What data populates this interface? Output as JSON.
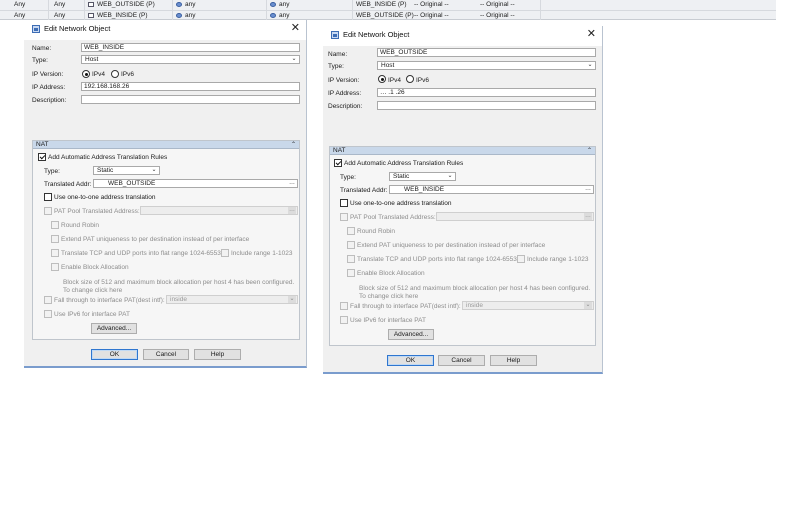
{
  "background_table": {
    "rows": [
      {
        "src_if": "Any",
        "dst_if": "Any",
        "src": "WEB_OUTSIDE (P)",
        "dst": "any",
        "svc": "any",
        "t_src": "WEB_INSIDE (P)",
        "t_dst": "-- Original --",
        "t_svc": "-- Original --"
      },
      {
        "src_if": "Any",
        "dst_if": "Any",
        "src": "WEB_INSIDE (P)",
        "dst": "any",
        "svc": "any",
        "t_src": "WEB_OUTSIDE (P)",
        "t_dst": "-- Original --",
        "t_svc": "-- Original --"
      }
    ]
  },
  "dialogs": [
    {
      "title": "Edit Network Object",
      "labels": {
        "name": "Name:",
        "type": "Type:",
        "ip_version": "IP Version:",
        "ip_address": "IP Address:",
        "description": "Description:"
      },
      "name_value": "WEB_INSIDE",
      "type_value": "Host",
      "ipv4_label": "IPv4",
      "ipv6_label": "IPv6",
      "ip_value": "192.168.168.26",
      "description_value": "",
      "nat": {
        "header": "NAT",
        "add_rules_label": "Add Automatic Address Translation Rules",
        "type_label": "Type:",
        "type_value": "Static",
        "translated_label": "Translated Addr:",
        "translated_value": "WEB_OUTSIDE",
        "one_to_one_label": "Use one-to-one address translation",
        "pat_pool_label": "PAT Pool Translated Address:",
        "round_robin_label": "Round Robin",
        "extend_pat_label": "Extend PAT uniqueness to per destination instead of per interface",
        "translate_tcp_label": "Translate TCP and UDP ports into flat range 1024-65535",
        "include_range_label": "Include range 1-1023",
        "block_alloc_label": "Enable Block Allocation",
        "block_note_1": "Block size of 512 and maximum block allocation per host 4 has been configured.",
        "block_note_2": "To change click here",
        "fall_through_label": "Fall through to interface PAT(dest intf):",
        "fall_through_value": "inside",
        "ipv6_pat_label": "Use IPv6 for interface PAT",
        "advanced_label": "Advanced..."
      },
      "ok_label": "OK",
      "cancel_label": "Cancel",
      "help_label": "Help"
    },
    {
      "title": "Edit Network Object",
      "labels": {
        "name": "Name:",
        "type": "Type:",
        "ip_version": "IP Version:",
        "ip_address": "IP Address:",
        "description": "Description:"
      },
      "name_value": "WEB_OUTSIDE",
      "type_value": "Host",
      "ipv4_label": "IPv4",
      "ipv6_label": "IPv6",
      "ip_value": "…  .1  .26",
      "description_value": "",
      "nat": {
        "header": "NAT",
        "add_rules_label": "Add Automatic Address Translation Rules",
        "type_label": "Type:",
        "type_value": "Static",
        "translated_label": "Translated Addr:",
        "translated_value": "WEB_INSIDE",
        "one_to_one_label": "Use one-to-one address translation",
        "pat_pool_label": "PAT Pool Translated Address:",
        "round_robin_label": "Round Robin",
        "extend_pat_label": "Extend PAT uniqueness to per destination instead of per interface",
        "translate_tcp_label": "Translate TCP and UDP ports into flat range 1024-65535",
        "include_range_label": "Include range 1-1023",
        "block_alloc_label": "Enable Block Allocation",
        "block_note_1": "Block size of 512 and maximum block allocation per host 4 has been configured.",
        "block_note_2": "To change click here",
        "fall_through_label": "Fall through to interface PAT(dest intf):",
        "fall_through_value": "inside",
        "ipv6_pat_label": "Use IPv6 for interface PAT",
        "advanced_label": "Advanced..."
      },
      "ok_label": "OK",
      "cancel_label": "Cancel",
      "help_label": "Help"
    }
  ],
  "colors": {
    "nat_header": "#c9d8ea",
    "dialog_bg": "#f0f0f0",
    "default_button_border": "#2f76cf"
  }
}
